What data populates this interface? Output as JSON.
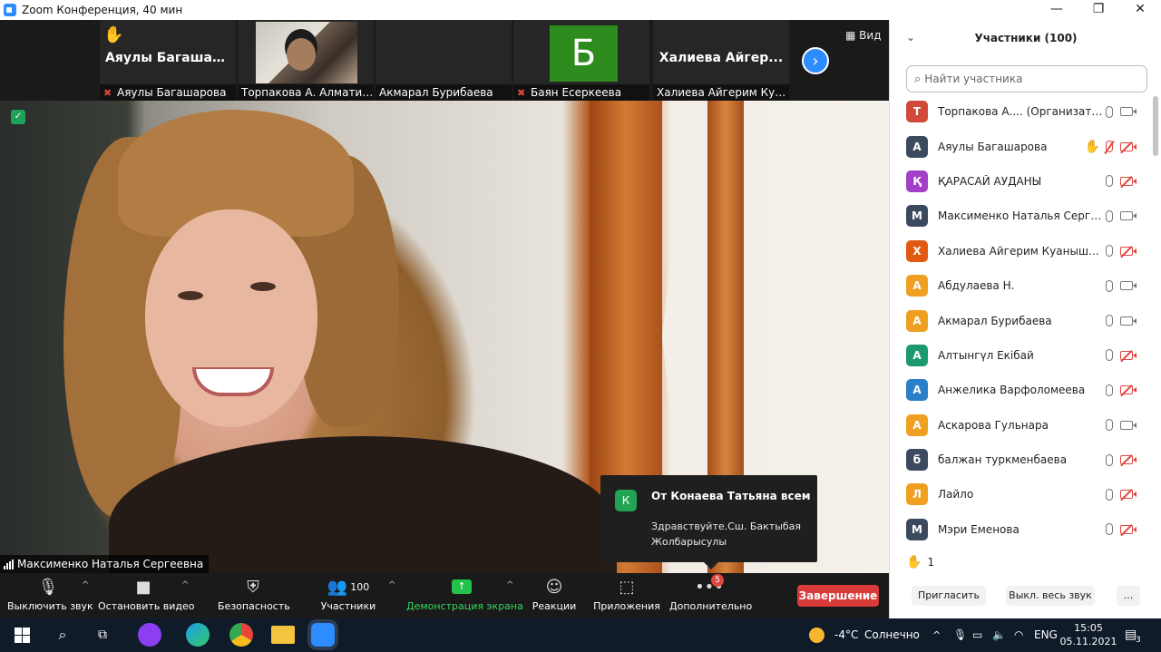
{
  "window": {
    "title": "Zoom Конференция, 40 мин",
    "controls": [
      "—",
      "❐",
      "✕"
    ]
  },
  "gallery": {
    "view_label": "Вид",
    "tiles": [
      {
        "display": "Аяулы  Багашар...",
        "caption": "Аяулы Багашарова",
        "mic_off": true,
        "hand_raised": true,
        "type": "name"
      },
      {
        "display": "",
        "caption": "Торпакова А. Алматинс...",
        "mic_off": false,
        "hand_raised": false,
        "type": "video"
      },
      {
        "display": "",
        "caption": "Акмарал Бурибаева",
        "mic_off": false,
        "hand_raised": false,
        "type": "blank"
      },
      {
        "display": "Б",
        "caption": "Баян Есеркеева",
        "mic_off": true,
        "hand_raised": false,
        "type": "avatar"
      },
      {
        "display": "Халиева  Айгер...",
        "caption": "Халиева Айгерим Куан...",
        "mic_off": false,
        "hand_raised": false,
        "type": "name"
      }
    ]
  },
  "speaker": {
    "name": "Максименко Наталья Сергеевна"
  },
  "chat_toast": {
    "avatar": "К",
    "from": "От Конаева Татьяна всем",
    "message": "Здравствуйте.Сш. Бактыбая Жолбарысулы"
  },
  "toolbar": {
    "mute": "Выключить звук",
    "stop_video": "Остановить видео",
    "security": "Безопасность",
    "participants": "Участники",
    "participants_count": "100",
    "share": "Демонстрация экрана",
    "reactions": "Реакции",
    "apps": "Приложения",
    "more": "Дополнительно",
    "more_badge": "5",
    "end": "Завершение"
  },
  "panel": {
    "title": "Участники (100)",
    "search_placeholder": "Найти участника",
    "participants": [
      {
        "initial": "Т",
        "color": "#d04a3a",
        "name": "Торпакова А.... (Организатор, я)",
        "hand": false,
        "mic": "on",
        "video": "on"
      },
      {
        "initial": "А",
        "color": "#3b4a5e",
        "name": "Аяулы Багашарова",
        "hand": true,
        "mic": "off",
        "video": "off"
      },
      {
        "initial": "Қ",
        "color": "#a23fc9",
        "name": "ҚАРАСАЙ АУДАНЫ",
        "hand": false,
        "mic": "on",
        "video": "off"
      },
      {
        "initial": "М",
        "color": "#3b4a5e",
        "name": "Максименко Наталья Сергеевна",
        "hand": false,
        "mic": "on",
        "video": "on"
      },
      {
        "initial": "Х",
        "color": "#e05a12",
        "name": "Халиева Айгерим Куанышбаев...",
        "hand": false,
        "mic": "on",
        "video": "off"
      },
      {
        "initial": "А",
        "color": "#f0a020",
        "name": "Абдулаева Н.",
        "hand": false,
        "mic": "on",
        "video": "on"
      },
      {
        "initial": "А",
        "color": "#f0a020",
        "name": "Акмарал Бурибаева",
        "hand": false,
        "mic": "on",
        "video": "on"
      },
      {
        "initial": "А",
        "color": "#1a9a6e",
        "name": "Алтынгүл Екібай",
        "hand": false,
        "mic": "on",
        "video": "off"
      },
      {
        "initial": "А",
        "color": "#2a7fc8",
        "name": "Анжелика Варфоломеева",
        "hand": false,
        "mic": "on",
        "video": "off"
      },
      {
        "initial": "А",
        "color": "#f0a020",
        "name": "Аскарова Гульнара",
        "hand": false,
        "mic": "on",
        "video": "on"
      },
      {
        "initial": "б",
        "color": "#3b4a5e",
        "name": "балжан туркменбаева",
        "hand": false,
        "mic": "on",
        "video": "off"
      },
      {
        "initial": "Л",
        "color": "#f0a020",
        "name": "Лайло",
        "hand": false,
        "mic": "on",
        "video": "off"
      },
      {
        "initial": "М",
        "color": "#3b4a5e",
        "name": "Мэри Еменова",
        "hand": false,
        "mic": "on",
        "video": "off"
      }
    ],
    "reactions_count": "1",
    "invite": "Пригласить",
    "mute_all": "Выкл. весь звук",
    "more": "..."
  },
  "taskbar": {
    "weather_temp": "-4°C",
    "weather_text": "Солнечно",
    "lang": "ENG",
    "time": "15:05",
    "date": "05.11.2021",
    "notifications": "3"
  },
  "colors": {
    "accent": "#2d8cff",
    "end": "#d93a3a",
    "share": "#22c24b",
    "muted": "#e0463d"
  }
}
